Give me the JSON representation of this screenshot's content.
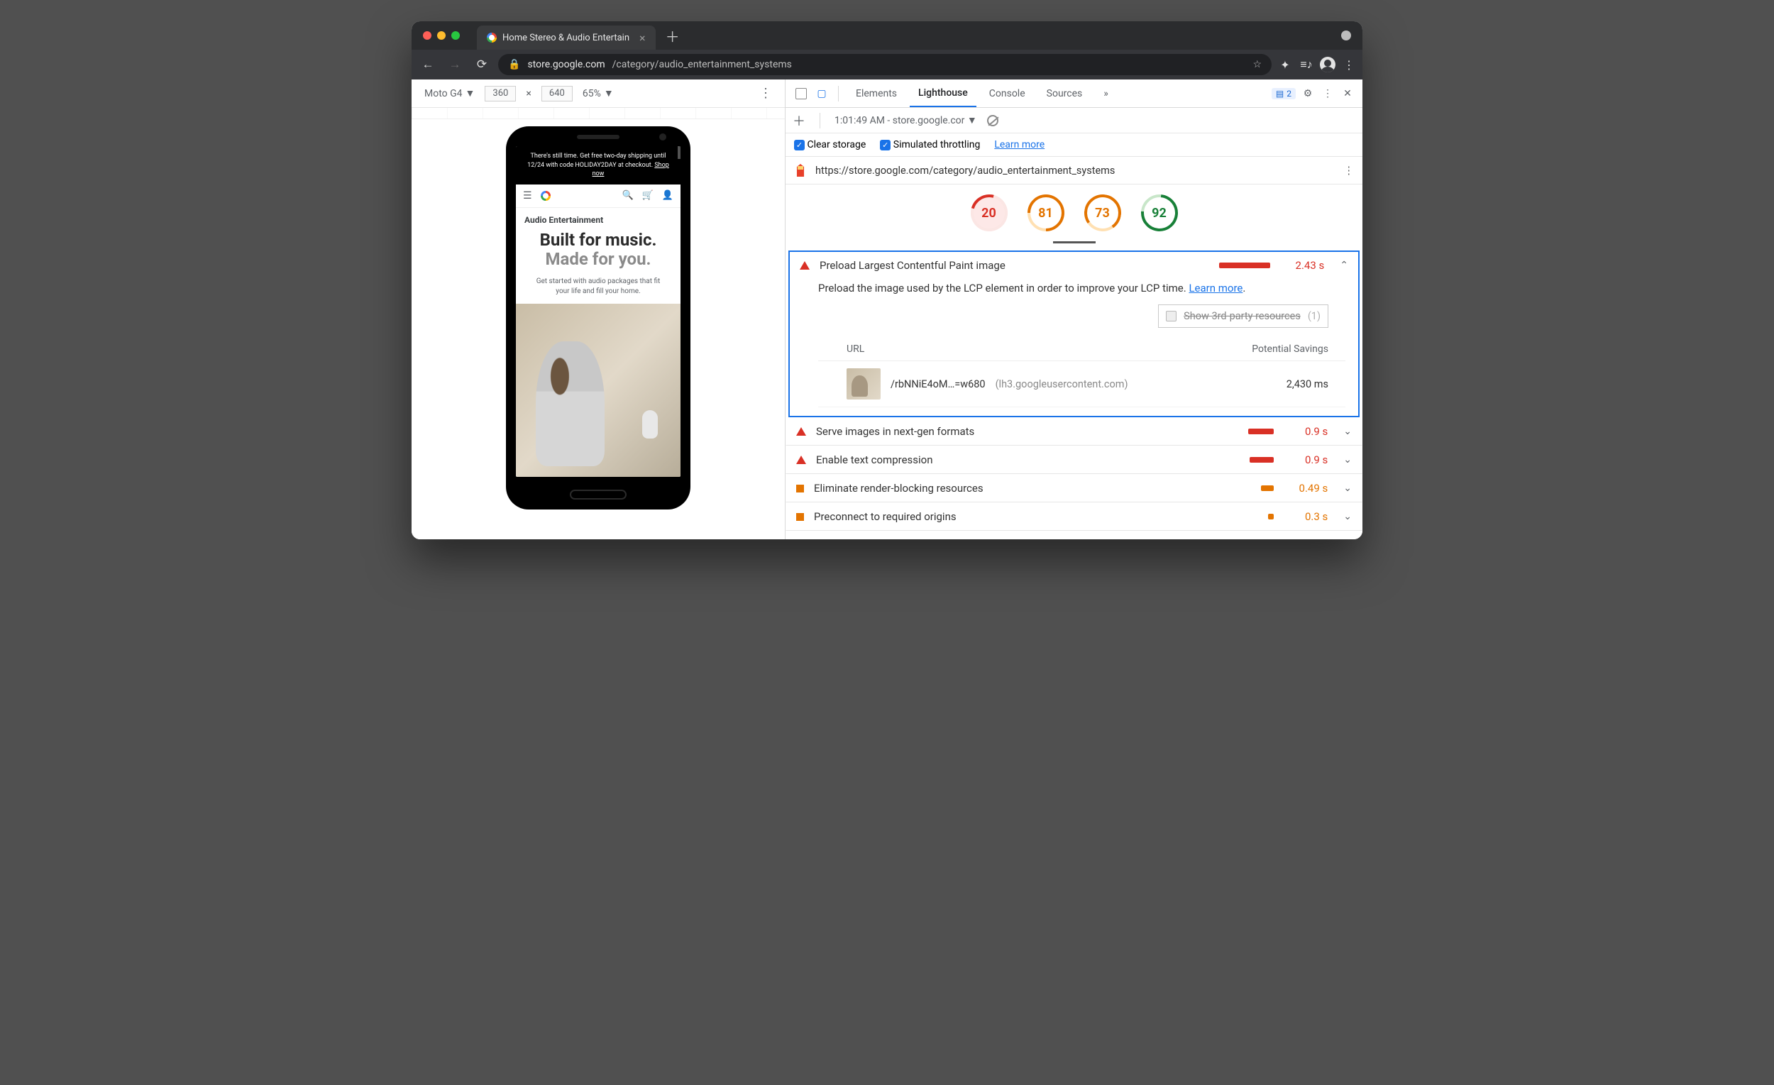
{
  "browser": {
    "tab_title": "Home Stereo & Audio Entertain",
    "url_host": "store.google.com",
    "url_path": "/category/audio_entertainment_systems"
  },
  "device_toolbar": {
    "device": "Moto G4",
    "width": "360",
    "height": "640",
    "zoom": "65%"
  },
  "page_preview": {
    "promo": "There's still time. Get free two-day shipping until 12/24 with code HOLIDAY2DAY at checkout.",
    "promo_link": "Shop now",
    "section": "Audio Entertainment",
    "title_bold": "Built for music.",
    "title_grey": "Made for you.",
    "subtitle": "Get started with audio packages that fit your life and fill your home."
  },
  "devtools": {
    "tabs": [
      "Elements",
      "Lighthouse",
      "Console",
      "Sources"
    ],
    "active_tab": "Lighthouse",
    "more": "»",
    "issues_count": "2",
    "run_label": "1:01:49 AM - store.google.cor",
    "cfg_clear": "Clear storage",
    "cfg_throttle": "Simulated throttling",
    "cfg_learn": "Learn more",
    "tested_url": "https://store.google.com/category/audio_entertainment_systems"
  },
  "gauges": {
    "perf": "20",
    "a11y": "81",
    "bp": "73",
    "seo": "92"
  },
  "audit_focus": {
    "title": "Preload Largest Contentful Paint image",
    "value": "2.43 s",
    "desc": "Preload the image used by the LCP element in order to improve your LCP time.",
    "learn": "Learn more",
    "third_party_label": "Show 3rd-party resources",
    "third_party_count": "(1)",
    "col_url": "URL",
    "col_savings": "Potential Savings",
    "row_url": "/rbNNiE4oM…=w680",
    "row_domain": "(lh3.googleusercontent.com)",
    "row_saving": "2,430 ms"
  },
  "audits": [
    {
      "title": "Serve images in next-gen formats",
      "value": "0.9 s",
      "sev": "red",
      "barw": "36px"
    },
    {
      "title": "Enable text compression",
      "value": "0.9 s",
      "sev": "red",
      "barw": "34px"
    },
    {
      "title": "Eliminate render-blocking resources",
      "value": "0.49 s",
      "sev": "or",
      "barw": "18px"
    },
    {
      "title": "Preconnect to required origins",
      "value": "0.3 s",
      "sev": "or",
      "barw": "8px"
    }
  ]
}
